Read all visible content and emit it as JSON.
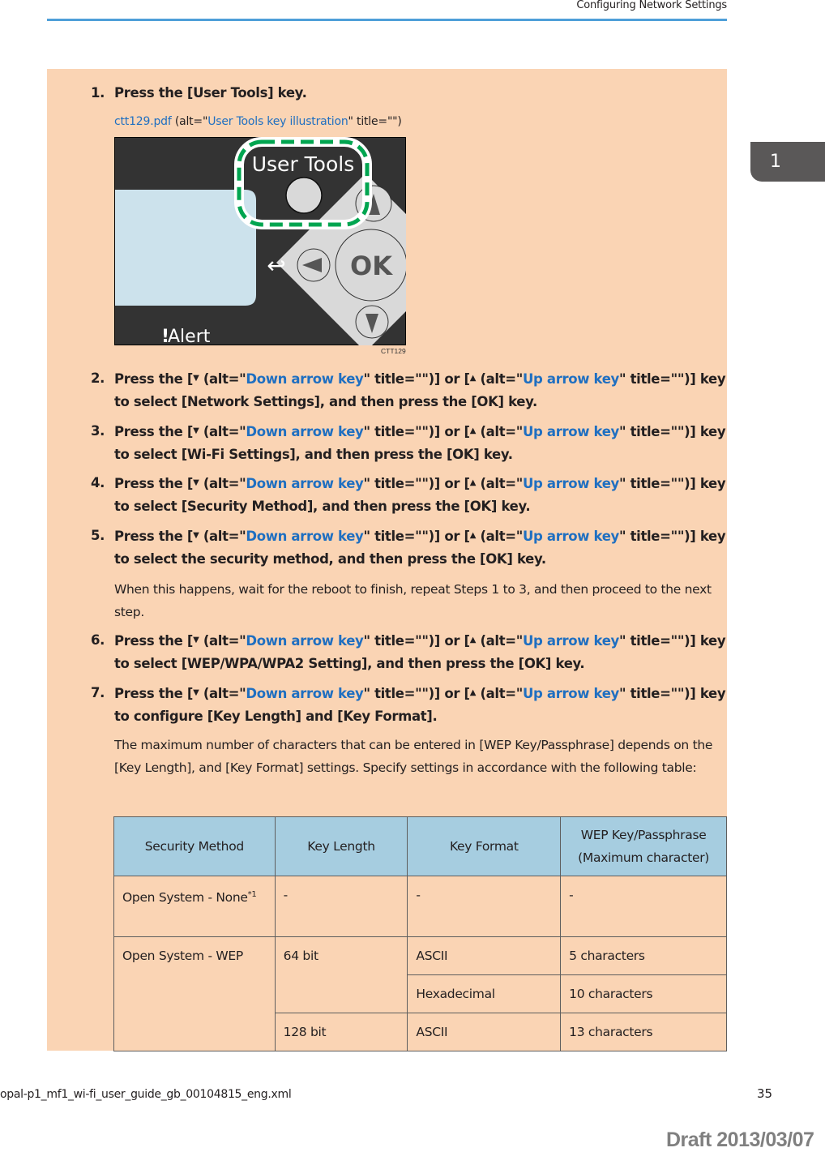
{
  "header": {
    "running_title": "Configuring Network Settings",
    "chapter_tab": "1",
    "rule_color": "#4f9fd9"
  },
  "steps": [
    {
      "num": "1.",
      "text": "Press the [User Tools] key."
    },
    {
      "num": "2.",
      "pre1": "Press the [",
      "down_glyph": "▼",
      "alt1_pre": " (alt=\"",
      "alt1": "Down arrow key",
      "alt1_post": "\" title=\"\")] or [",
      "up_glyph": "▲",
      "alt2_pre": " (alt=\"",
      "alt2": "Up arrow key",
      "alt2_post": "\" title=\"\")] key",
      "line2": "to select [Network Settings], and then press the [OK] key."
    },
    {
      "num": "3.",
      "pre1": "Press the [",
      "down_glyph": "▼",
      "alt1_pre": " (alt=\"",
      "alt1": "Down arrow key",
      "alt1_post": "\" title=\"\")] or [",
      "up_glyph": "▲",
      "alt2_pre": " (alt=\"",
      "alt2": "Up arrow key",
      "alt2_post": "\" title=\"\")] key",
      "line2": "to select [Wi-Fi Settings], and then press the [OK] key."
    },
    {
      "num": "4.",
      "pre1": "Press the [",
      "down_glyph": "▼",
      "alt1_pre": " (alt=\"",
      "alt1": "Down arrow key",
      "alt1_post": "\" title=\"\")] or [",
      "up_glyph": "▲",
      "alt2_pre": " (alt=\"",
      "alt2": "Up arrow key",
      "alt2_post": "\" title=\"\")] key",
      "line2": "to select [Security Method], and then press the [OK] key."
    },
    {
      "num": "5.",
      "pre1": "Press the [",
      "down_glyph": "▼",
      "alt1_pre": " (alt=\"",
      "alt1": "Down arrow key",
      "alt1_post": "\" title=\"\")] or [",
      "up_glyph": "▲",
      "alt2_pre": " (alt=\"",
      "alt2": "Up arrow key",
      "alt2_post": "\" title=\"\")] key",
      "line2": "to select the security method, and then press the [OK] key."
    },
    {
      "num": "6.",
      "pre1": "Press the [",
      "down_glyph": "▼",
      "alt1_pre": " (alt=\"",
      "alt1": "Down arrow key",
      "alt1_post": "\" title=\"\")] or [",
      "up_glyph": "▲",
      "alt2_pre": " (alt=\"",
      "alt2": "Up arrow key",
      "alt2_post": "\" title=\"\")] key",
      "line2": "to select [WEP/WPA/WPA2 Setting], and then press the [OK] key."
    },
    {
      "num": "7.",
      "pre1": "Press the [",
      "down_glyph": "▼",
      "alt1_pre": " (alt=\"",
      "alt1": "Down arrow key",
      "alt1_post": "\" title=\"\")] or [",
      "up_glyph": "▲",
      "alt2_pre": " (alt=\"",
      "alt2": "Up arrow key",
      "alt2_post": "\" title=\"\")] key",
      "line2": "to configure [Key Length] and [Key Format]."
    }
  ],
  "figure": {
    "file_link": "ctt129.pdf",
    "caption_pre": " (alt=\"",
    "alt_text": "User Tools key illustration",
    "caption_post": "\" title=\"\")",
    "user_tools_label": "User Tools",
    "ok_label": "OK",
    "alert_label": "Alert",
    "alert_glyph": "!",
    "back_glyph": "↩",
    "code": "CTT129",
    "highlight_color": "#00a550",
    "panel_color": "#333333",
    "lcd_color": "#cce2ec",
    "key_color": "#d9d9d9"
  },
  "notes": {
    "step5": "When this happens, wait for the reboot to finish, repeat Steps 1 to 3, and then proceed to the next step.",
    "step7": "The maximum number of characters that can be entered in [WEP Key/Passphrase] depends on the [Key Length], and [Key Format] settings. Specify settings in accordance with the following table:"
  },
  "table": {
    "headers": [
      "Security Method",
      "Key Length",
      "Key Format",
      "WEP Key/Passphrase (Maximum character)"
    ],
    "header_line1_col4": "WEP Key/Passphrase",
    "header_line2_col4": "(Maximum character)",
    "rows": [
      {
        "method": "Open System - None",
        "method_sup": "*1",
        "length": "-",
        "format": "-",
        "max": "-"
      },
      {
        "method": "Open System - WEP",
        "length": "64 bit",
        "format": "ASCII",
        "max": "5 characters"
      },
      {
        "format": "Hexadecimal",
        "max": "10 characters"
      },
      {
        "length": "128 bit",
        "format": "ASCII",
        "max": "13 characters"
      }
    ],
    "header_bg": "#a6cde0"
  },
  "footer": {
    "filename": "opal-p1_mf1_wi-fi_user_guide_gb_00104815_eng.xml",
    "page_number": "35",
    "draft_stamp": "Draft 2013/03/07"
  },
  "colors": {
    "peach_bg": "#fad4b4",
    "link_blue": "#1f6fc1"
  }
}
